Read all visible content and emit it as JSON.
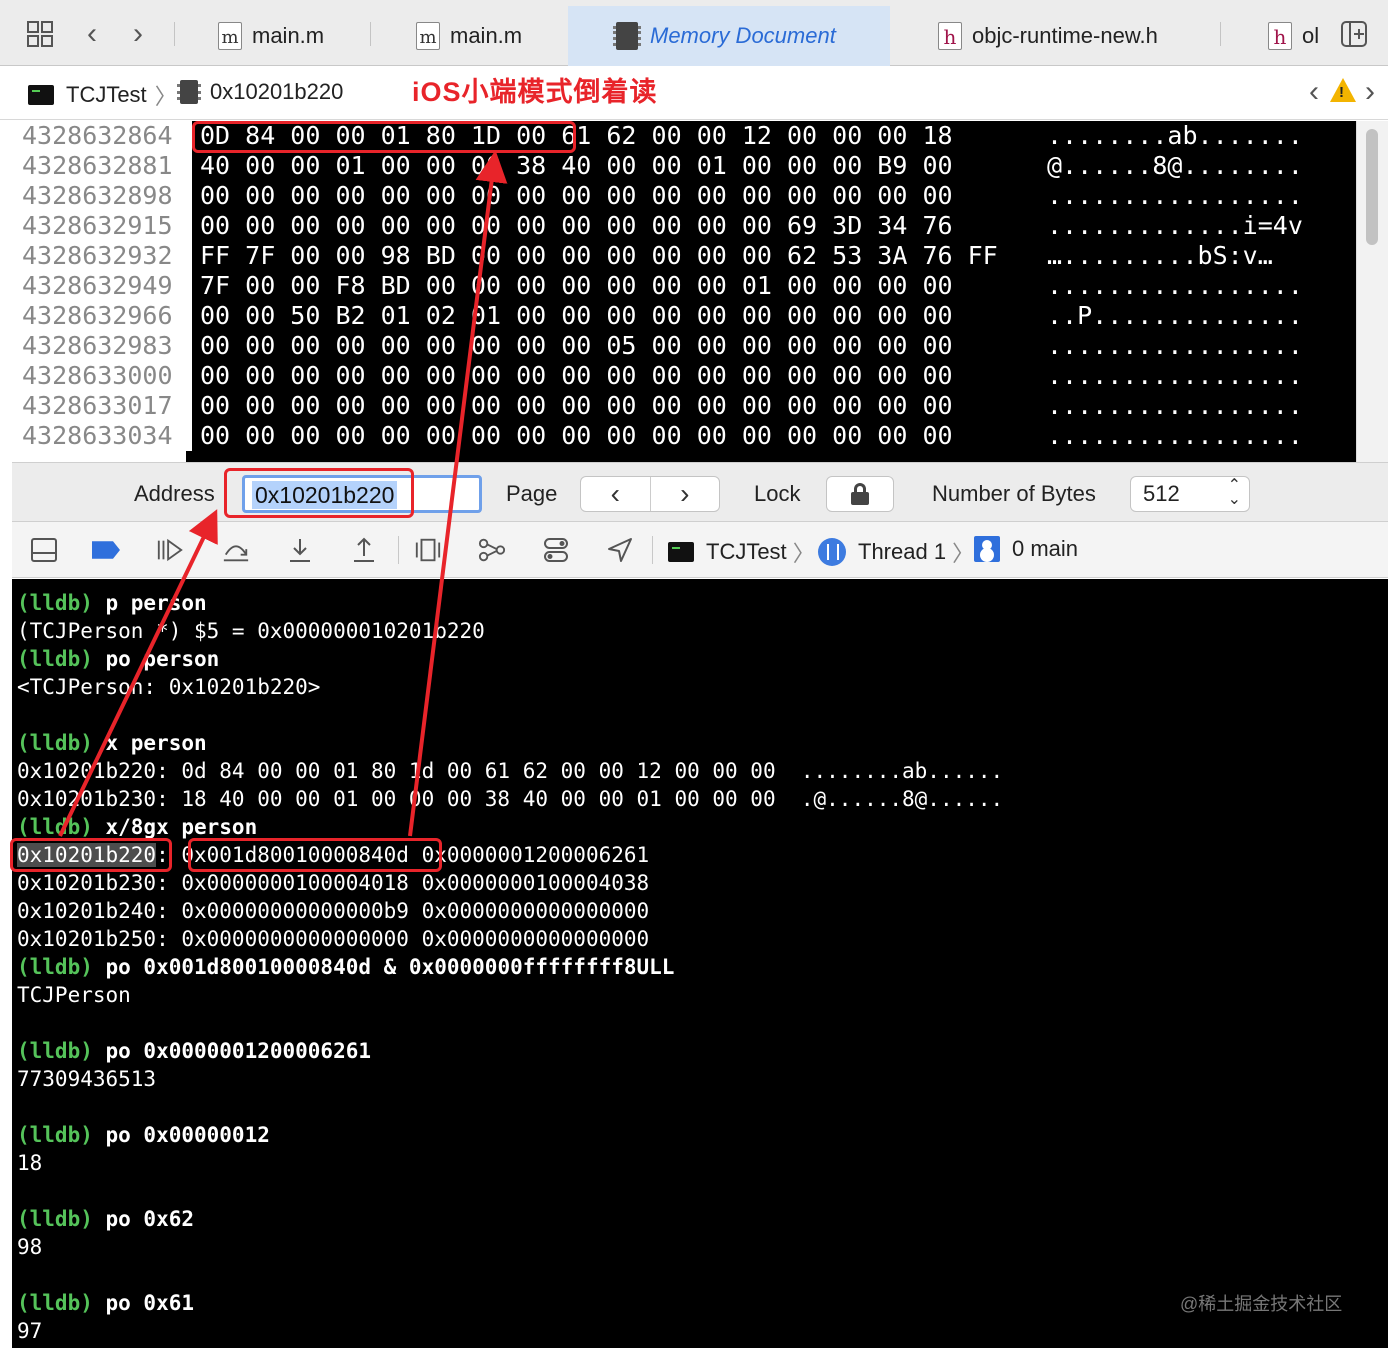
{
  "tabbar": {
    "tabs": [
      {
        "label": "main.m",
        "icon": "m"
      },
      {
        "label": "main.m",
        "icon": "m"
      },
      {
        "label": "Memory Document",
        "active": true
      },
      {
        "label": "objc-runtime-new.h",
        "icon": "h"
      },
      {
        "label": "ol",
        "icon": "h"
      }
    ]
  },
  "jumpbar": {
    "project": "TCJTest",
    "document": "0x10201b220"
  },
  "annotation": {
    "title": "iOS小端模式倒着读"
  },
  "memory": {
    "rows": [
      {
        "addr": "4328632864",
        "bytes": "0D 84 00 00 01 80 1D 00 61 62 00 00 12 00 00 00 18",
        "ascii": "........ab......."
      },
      {
        "addr": "4328632881",
        "bytes": "40 00 00 01 00 00 00 38 40 00 00 01 00 00 00 B9 00",
        "ascii": "@......8@........"
      },
      {
        "addr": "4328632898",
        "bytes": "00 00 00 00 00 00 00 00 00 00 00 00 00 00 00 00 00",
        "ascii": "................."
      },
      {
        "addr": "4328632915",
        "bytes": "00 00 00 00 00 00 00 00 00 00 00 00 00 69 3D 34 76",
        "ascii": ".............i=4v"
      },
      {
        "addr": "4328632932",
        "bytes": "FF 7F 00 00 98 BD 00 00 00 00 00 00 00 62 53 3A 76 FF",
        "ascii": "….........bS:v…"
      },
      {
        "addr": "4328632949",
        "bytes": "7F 00 00 F8 BD 00 00 00 00 00 00 00 01 00 00 00 00",
        "ascii": "................."
      },
      {
        "addr": "4328632966",
        "bytes": "00 00 50 B2 01 02 01 00 00 00 00 00 00 00 00 00 00",
        "ascii": "..P.............."
      },
      {
        "addr": "4328632983",
        "bytes": "00 00 00 00 00 00 00 00 00 05 00 00 00 00 00 00 00",
        "ascii": "................."
      },
      {
        "addr": "4328633000",
        "bytes": "00 00 00 00 00 00 00 00 00 00 00 00 00 00 00 00 00",
        "ascii": "................."
      },
      {
        "addr": "4328633017",
        "bytes": "00 00 00 00 00 00 00 00 00 00 00 00 00 00 00 00 00",
        "ascii": "................."
      },
      {
        "addr": "4328633034",
        "bytes": "00 00 00 00 00 00 00 00 00 00 00 00 00 00 00 00 00",
        "ascii": "................."
      }
    ]
  },
  "addressbar": {
    "address_label": "Address",
    "address_value": "0x10201b220",
    "page_label": "Page",
    "lock_label": "Lock",
    "bytes_label": "Number of Bytes",
    "bytes_value": "512"
  },
  "debugbar": {
    "target": "TCJTest",
    "thread": "Thread 1",
    "frame": "0 main"
  },
  "console": {
    "lines": [
      {
        "prompt": "(lldb)",
        "text": " p person"
      },
      {
        "text": "(TCJPerson *) $5 = 0x000000010201b220"
      },
      {
        "prompt": "(lldb)",
        "text": " po person"
      },
      {
        "text": "<TCJPerson: 0x10201b220>"
      },
      {
        "text": ""
      },
      {
        "prompt": "(lldb)",
        "text": " x person"
      },
      {
        "text": "0x10201b220: 0d 84 00 00 01 80 1d 00 61 62 00 00 12 00 00 00  ........ab......"
      },
      {
        "text": "0x10201b230: 18 40 00 00 01 00 00 00 38 40 00 00 01 00 00 00  .@......8@......"
      },
      {
        "prompt": "(lldb)",
        "text": " x/8gx person"
      },
      {
        "hl": "0x10201b220",
        "text": ": 0x001d80010000840d 0x0000001200006261"
      },
      {
        "text": "0x10201b230: 0x0000000100004018 0x0000000100004038"
      },
      {
        "text": "0x10201b240: 0x00000000000000b9 0x0000000000000000"
      },
      {
        "text": "0x10201b250: 0x0000000000000000 0x0000000000000000"
      },
      {
        "prompt": "(lldb)",
        "text": " po 0x001d80010000840d & 0x0000000ffffffff8ULL"
      },
      {
        "text": "TCJPerson"
      },
      {
        "text": ""
      },
      {
        "prompt": "(lldb)",
        "text": " po 0x0000001200006261"
      },
      {
        "text": "77309436513"
      },
      {
        "text": ""
      },
      {
        "prompt": "(lldb)",
        "text": " po 0x00000012"
      },
      {
        "text": "18"
      },
      {
        "text": ""
      },
      {
        "prompt": "(lldb)",
        "text": " po 0x62"
      },
      {
        "text": "98"
      },
      {
        "text": ""
      },
      {
        "prompt": "(lldb)",
        "text": " po 0x61"
      },
      {
        "text": "97"
      }
    ],
    "watermark": "@稀土掘金技术社区"
  },
  "colors": {
    "annotation_red": "#e8242a",
    "prompt_green": "#55c35a",
    "active_tab_blue": "#2a6bd6"
  }
}
